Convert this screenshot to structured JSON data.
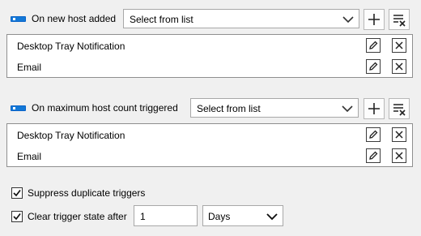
{
  "sections": [
    {
      "label": "On new host added",
      "select_value": "Select from list",
      "items": [
        "Desktop Tray Notification",
        "Email"
      ]
    },
    {
      "label": "On maximum host count  triggered",
      "select_value": "Select from list",
      "items": [
        "Desktop Tray Notification",
        "Email"
      ]
    }
  ],
  "options": {
    "suppress_label": "Suppress duplicate triggers",
    "suppress_checked": true,
    "clear_label": "Clear trigger state after",
    "clear_checked": true,
    "clear_value": "1",
    "clear_unit": "Days"
  },
  "colors": {
    "toggle_accent": "#1378d7"
  },
  "icons": [
    "toggle-icon",
    "chevron-down-icon",
    "plus-icon",
    "clear-list-icon",
    "pencil-icon",
    "close-icon",
    "checkmark-icon"
  ]
}
